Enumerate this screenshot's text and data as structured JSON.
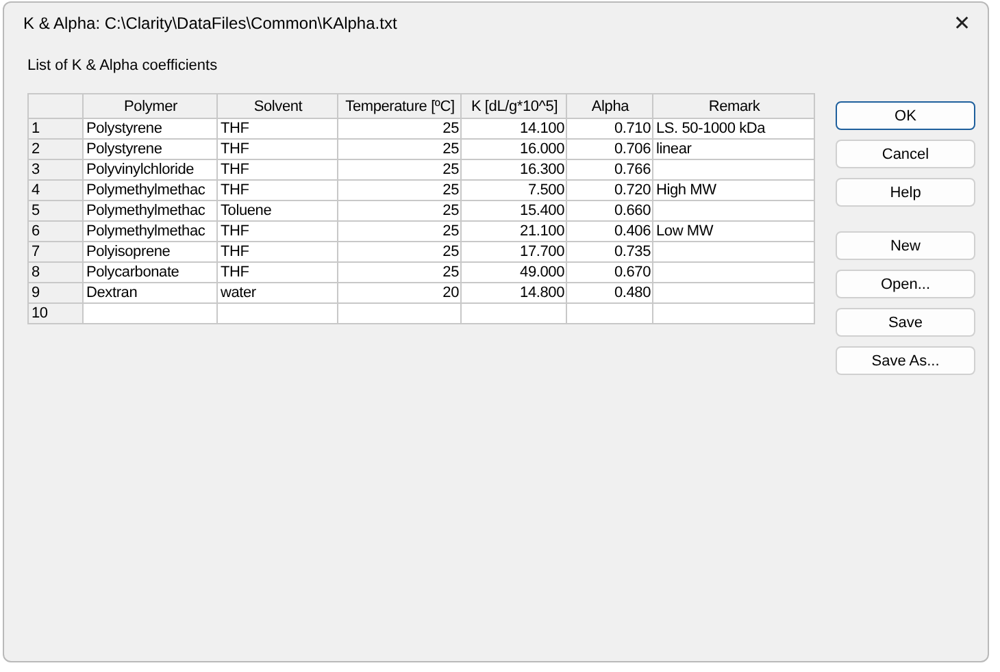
{
  "window": {
    "title": "K & Alpha: C:\\Clarity\\DataFiles\\Common\\KAlpha.txt",
    "close": "✕"
  },
  "list_label": "List of K & Alpha coefficients",
  "table": {
    "columns": [
      "Polymer",
      "Solvent",
      "Temperature [ºC]",
      "K [dL/g*10^5]",
      "Alpha",
      "Remark"
    ],
    "rows": [
      {
        "number": "1",
        "polymer": "Polystyrene",
        "solvent": "THF",
        "temperature": "25",
        "k": "14.100",
        "alpha": "0.710",
        "remark": "LS. 50-1000 kDa"
      },
      {
        "number": "2",
        "polymer": "Polystyrene",
        "solvent": "THF",
        "temperature": "25",
        "k": "16.000",
        "alpha": "0.706",
        "remark": "linear"
      },
      {
        "number": "3",
        "polymer": "Polyvinylchloride",
        "solvent": "THF",
        "temperature": "25",
        "k": "16.300",
        "alpha": "0.766"
      },
      {
        "number": "4",
        "polymer": "Polymethylmethac",
        "solvent": "THF",
        "temperature": "25",
        "k": "7.500",
        "alpha": "0.720",
        "remark": "High MW"
      },
      {
        "number": "5",
        "polymer": "Polymethylmethac",
        "solvent": "Toluene",
        "temperature": "25",
        "k": "15.400",
        "alpha": "0.660"
      },
      {
        "number": "6",
        "polymer": "Polymethylmethac",
        "solvent": "THF",
        "temperature": "25",
        "k": "21.100",
        "alpha": "0.406",
        "remark": "Low MW"
      },
      {
        "number": "7",
        "polymer": "Polyisoprene",
        "solvent": "THF",
        "temperature": "25",
        "k": "17.700",
        "alpha": "0.735"
      },
      {
        "number": "8",
        "polymer": "Polycarbonate",
        "solvent": "THF",
        "temperature": "25",
        "k": "49.000",
        "alpha": "0.670"
      },
      {
        "number": "9",
        "polymer": "Dextran",
        "solvent": "water",
        "temperature": "20",
        "k": "14.800",
        "alpha": "0.480"
      },
      {
        "number": "10"
      }
    ]
  },
  "button_groups": [
    {
      "buttons": [
        {
          "label": "OK",
          "default": true
        },
        {
          "label": "Cancel",
          "default": false
        },
        {
          "label": "Help",
          "default": false
        }
      ]
    },
    {
      "buttons": [
        {
          "label": "New",
          "default": false
        },
        {
          "label": "Open...",
          "default": false
        },
        {
          "label": "Save",
          "default": false
        },
        {
          "label": "Save As...",
          "default": false
        }
      ]
    }
  ]
}
